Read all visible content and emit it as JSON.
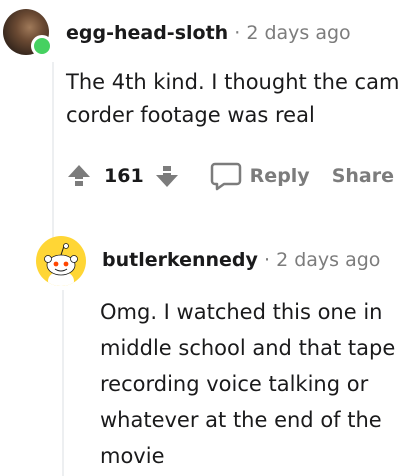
{
  "comments": [
    {
      "username": "egg-head-sloth",
      "separator": "·",
      "timestamp": "2 days ago",
      "body": "The 4th kind. I thought the cam corder footage was real",
      "score": "161",
      "reply_label": "Reply",
      "share_label": "Share",
      "online_color": "#46d160"
    },
    {
      "username": "butlerkennedy",
      "separator": "·",
      "timestamp": "2 days ago",
      "body": "Omg. I watched this one in middle school and that tape recording voice talking or whatever at the end of the movie"
    }
  ]
}
